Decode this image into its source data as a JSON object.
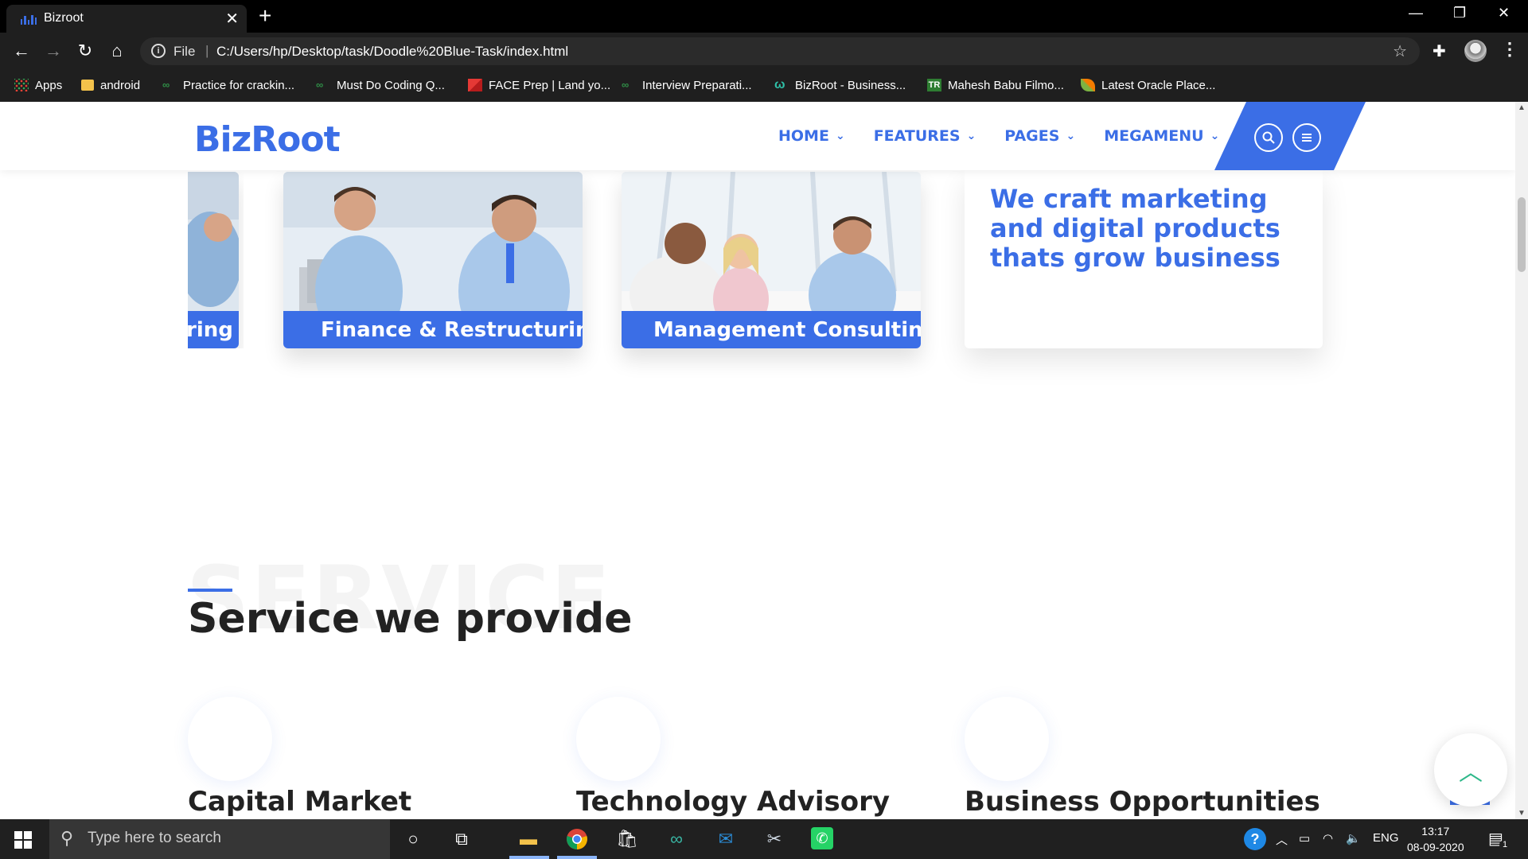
{
  "browser": {
    "tab_title": "Bizroot",
    "url_scheme": "File",
    "url": "C:/Users/hp/Desktop/task/Doodle%20Blue-Task/index.html",
    "bookmarks": [
      {
        "label": "Apps",
        "icon": "apps-grid-icon"
      },
      {
        "label": "android",
        "icon": "folder-icon"
      },
      {
        "label": "Practice for crackin...",
        "icon": "gfg-icon"
      },
      {
        "label": "Must Do Coding Q...",
        "icon": "gfg-icon"
      },
      {
        "label": "FACE Prep | Land yo...",
        "icon": "faceprep-icon"
      },
      {
        "label": "Interview Preparati...",
        "icon": "gfg-icon"
      },
      {
        "label": "BizRoot - Business...",
        "icon": "bizroot-icon"
      },
      {
        "label": "Mahesh Babu Filmo...",
        "icon": "tr-icon"
      },
      {
        "label": "Latest Oracle Place...",
        "icon": "leaf-icon"
      }
    ]
  },
  "site": {
    "logo": "BizRoot",
    "nav": [
      "HOME",
      "FEATURES",
      "PAGES",
      "MEGAMENU"
    ],
    "cards": [
      {
        "label": "ring"
      },
      {
        "label": "Finance & Restructuring"
      },
      {
        "label": "Management Consulting"
      }
    ],
    "tagline": "We craft marketing and digital products thats grow business",
    "section_bg_word": "SERVICE",
    "section_title": "Service we provide",
    "services": [
      "Capital Market",
      "Technology Advisory",
      "Business Opportunities"
    ],
    "accent_color": "#3b6ee6"
  },
  "taskbar": {
    "search_placeholder": "Type here to search",
    "language": "ENG",
    "time": "13:17",
    "date": "08-09-2020",
    "notification_count": "1"
  }
}
